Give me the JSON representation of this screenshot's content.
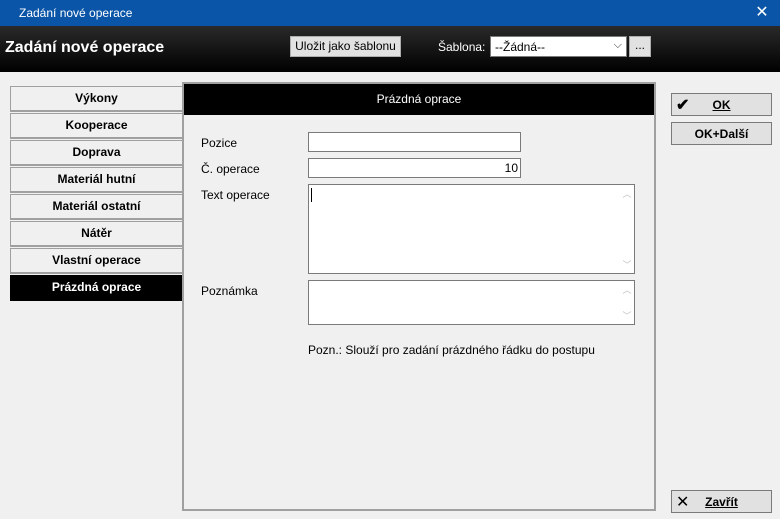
{
  "window": {
    "title": "Zadání nové operace",
    "close_glyph": "✕"
  },
  "header": {
    "title": "Zadání nové operace",
    "save_template_label": "Uložit jako šablonu",
    "template_label": "Šablona:",
    "template_value": "--Žádná--",
    "dots_label": "..."
  },
  "tabs": [
    {
      "label": "Výkony"
    },
    {
      "label": "Kooperace"
    },
    {
      "label": "Doprava"
    },
    {
      "label": "Materiál hutní"
    },
    {
      "label": "Materiál ostatní"
    },
    {
      "label": "Nátěr"
    },
    {
      "label": "Vlastní operace"
    },
    {
      "label": "Prázdná oprace",
      "active": true
    }
  ],
  "panel": {
    "title": "Prázdná oprace",
    "pozice_label": "Pozice",
    "pozice_value": "",
    "cislo_label": "Č. operace",
    "cislo_value": "10",
    "text_label": "Text operace",
    "text_value": "",
    "poznamka_label": "Poznámka",
    "poznamka_value": "",
    "note": "Pozn.: Slouží pro zadání prázdného řádku do postupu"
  },
  "buttons": {
    "ok_label": "OK",
    "ok_next_label": "OK+Další",
    "close_label": "Zavřít"
  },
  "icons": {
    "ok": "check-icon",
    "close": "close-icon"
  }
}
